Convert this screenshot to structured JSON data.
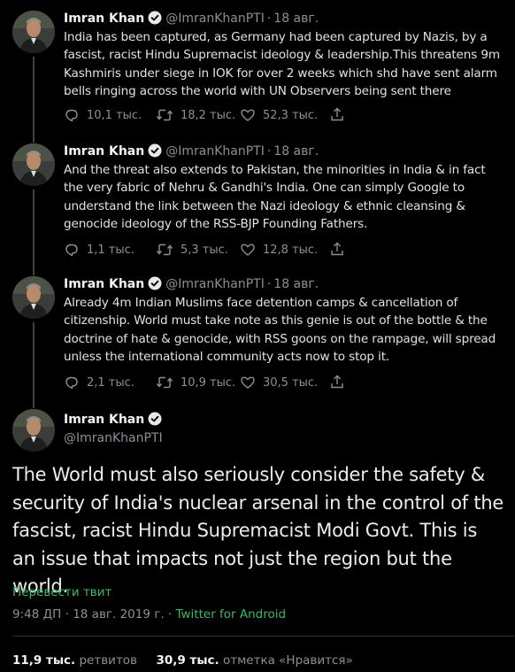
{
  "thread": [
    {
      "author": "Imran Khan",
      "handle": "@ImranKhanPTI",
      "separator": "·",
      "date": "18 авг.",
      "text": "India has been captured, as Germany had been captured by Nazis, by a fascist, racist Hindu Supremacist ideology & leadership.This threatens 9m Kashmiris under siege in IOK for over 2 weeks which shd have sent alarm bells ringing across the world with UN Observers being sent there",
      "replies": "10,1 тыс.",
      "retweets": "18,2 тыс.",
      "likes": "52,3 тыс."
    },
    {
      "author": "Imran Khan",
      "handle": "@ImranKhanPTI",
      "separator": "·",
      "date": "18 авг.",
      "text": "And the threat also extends to Pakistan, the minorities in India & in fact the very fabric of Nehru & Gandhi's India. One can simply Google to understand the link between the Nazi ideology & ethnic cleansing & genocide ideology of the RSS-BJP Founding Fathers.",
      "replies": "1,1 тыс.",
      "retweets": "5,3 тыс.",
      "likes": "12,8 тыс."
    },
    {
      "author": "Imran Khan",
      "handle": "@ImranKhanPTI",
      "separator": "·",
      "date": "18 авг.",
      "text": "Already 4m Indian Muslims face detention camps & cancellation of citizenship. World must take note as this genie is out of the bottle & the doctrine of hate & genocide, with RSS goons on the rampage, will spread unless the international community acts now to stop it.",
      "replies": "2,1 тыс.",
      "retweets": "10,9 тыс.",
      "likes": "30,5 тыс."
    }
  ],
  "main_tweet": {
    "author": "Imran Khan",
    "handle": "@ImranKhanPTI",
    "text": "The World must also seriously consider  the safety & security of India's nuclear arsenal in the control of the fascist, racist Hindu Supremacist Modi Govt. This is an issue that impacts not just the region but the world.",
    "translate": "Перевести твит",
    "time": "9:48 ДП",
    "meta_separator": "·",
    "date": "18 авг. 2019 г.",
    "source": "Twitter for Android",
    "retweets_count": "11,9 тыс.",
    "retweets_label": "ретвитов",
    "likes_count": "30,9 тыс.",
    "likes_label": "отметка «Нравится»"
  },
  "icons": {
    "reply": "reply-icon",
    "retweet": "retweet-icon",
    "like": "heart-icon",
    "share": "share-icon",
    "verified": "verified-badge-icon"
  },
  "colors": {
    "background": "#000000",
    "text": "#e2e2e2",
    "muted": "#8a9096",
    "accent_green": "#3db76a",
    "thread_line": "#3b4249"
  }
}
